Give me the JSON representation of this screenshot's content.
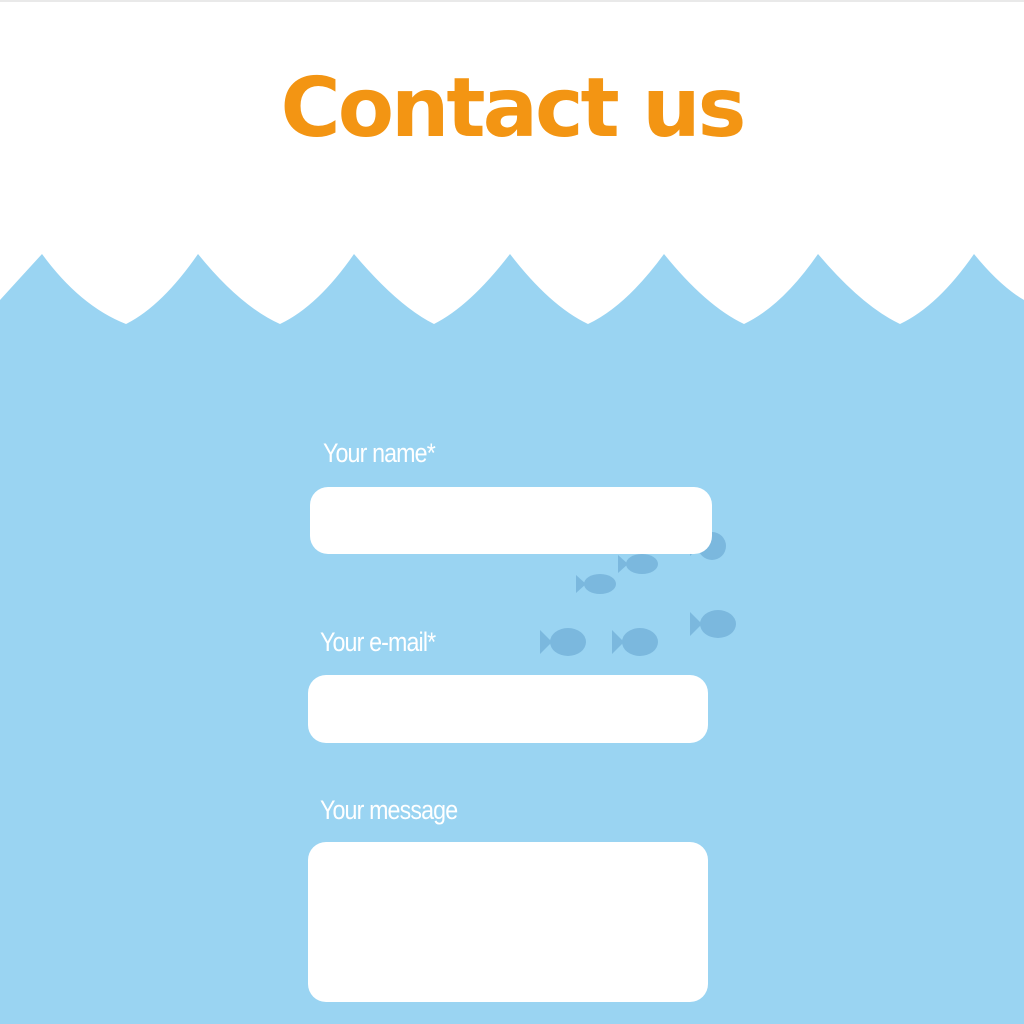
{
  "header": {
    "title": "Contact us"
  },
  "form": {
    "name_label": "Your name*",
    "name_value": "",
    "email_label": "Your e-mail*",
    "email_value": "",
    "message_label": "Your message",
    "message_value": ""
  },
  "colors": {
    "title": "#f39513",
    "water": "#9ad4f2",
    "fish": "#7bb8de",
    "field_background": "#ffffff",
    "label_text": "#ffffff"
  },
  "decorations": {
    "fish_icon": "fish-icon",
    "wave_icon": "wave-icon"
  }
}
